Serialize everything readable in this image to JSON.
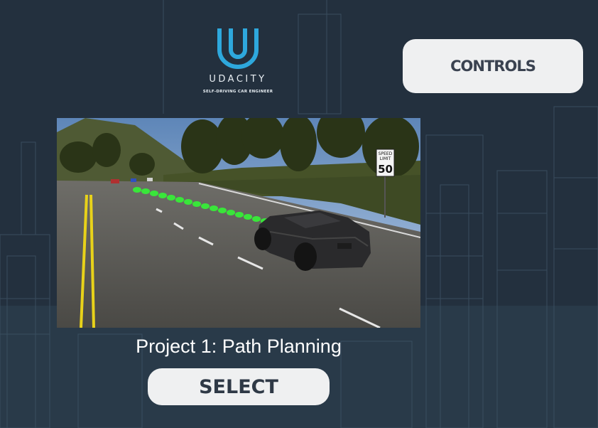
{
  "brand": {
    "name": "UDACITY",
    "tagline": "SELF-DRIVING CAR ENGINEER",
    "accent": "#2ea8dd"
  },
  "header": {
    "controls_label": "CONTROLS"
  },
  "preview": {
    "sign_line1": "SPEED",
    "sign_line2": "LIMIT",
    "sign_value": "50"
  },
  "project": {
    "title": "Project 1: Path Planning",
    "select_label": "SELECT"
  },
  "colors": {
    "background": "#23303e",
    "button_bg": "#eff0f1",
    "path_green": "#39e63a",
    "lane_yellow": "#e8d21a"
  }
}
